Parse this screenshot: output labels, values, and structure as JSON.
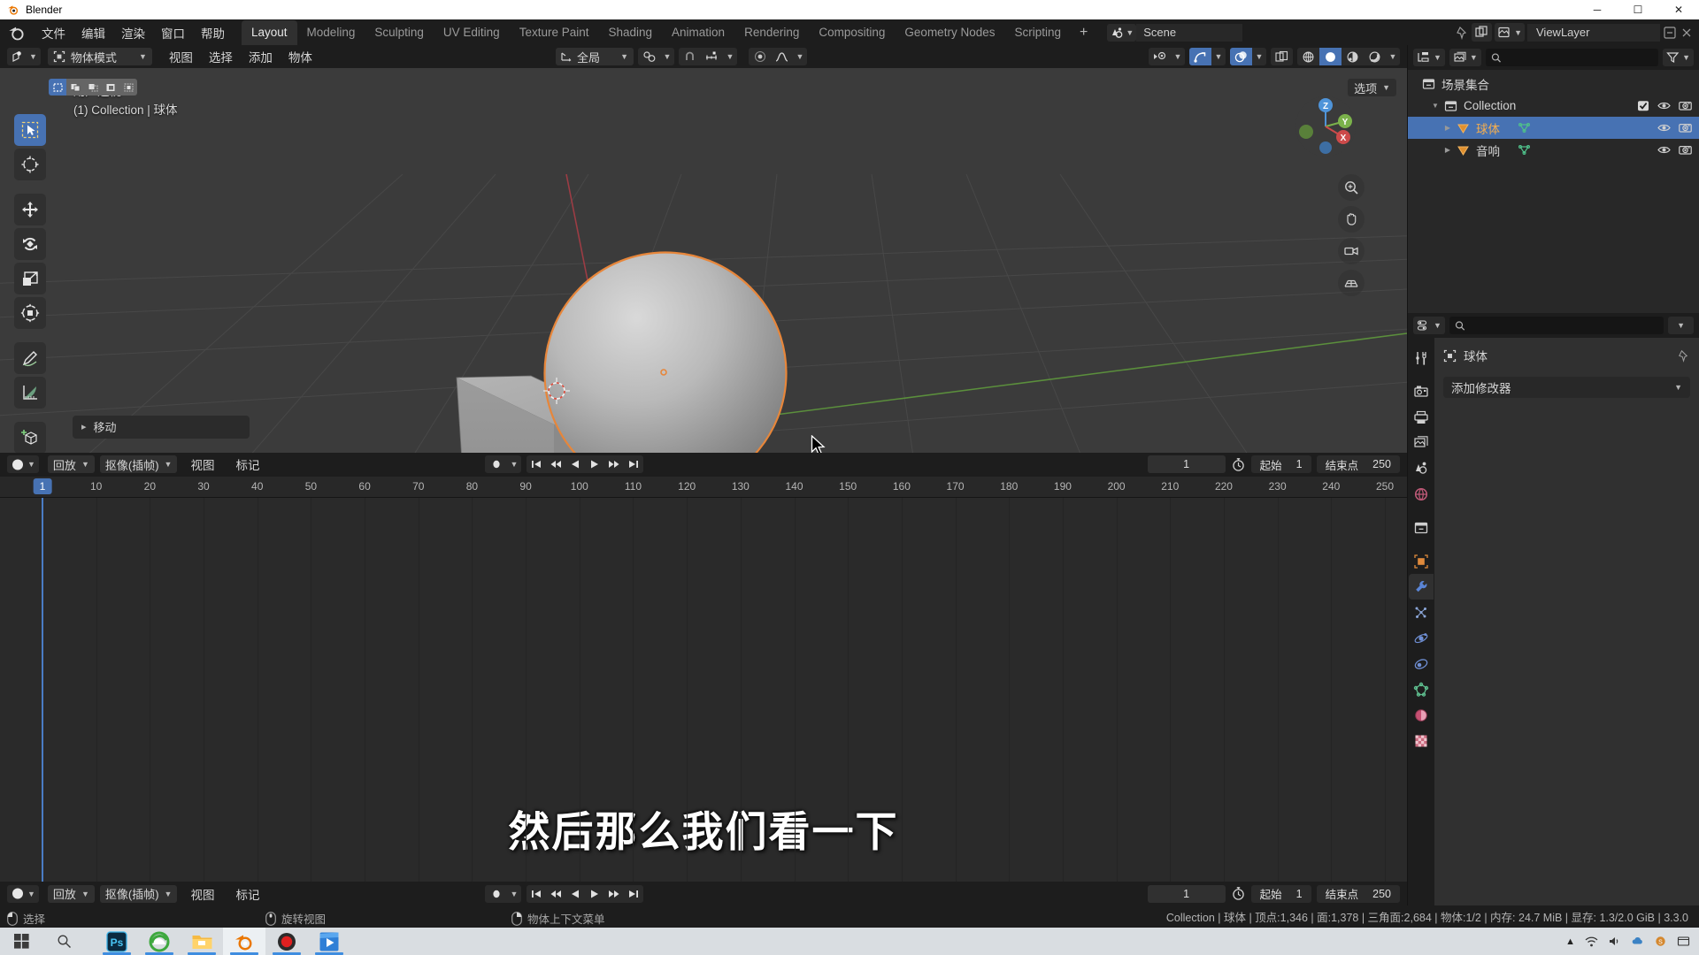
{
  "os": {
    "title": "Blender",
    "window_controls": [
      "minimize",
      "maximize",
      "close"
    ],
    "min_glyph": "─",
    "max_glyph": "☐",
    "close_glyph": "✕"
  },
  "topbar": {
    "menus": [
      "文件",
      "编辑",
      "渲染",
      "窗口",
      "帮助"
    ],
    "workspaces": [
      "Layout",
      "Modeling",
      "Sculpting",
      "UV Editing",
      "Texture Paint",
      "Shading",
      "Animation",
      "Rendering",
      "Compositing",
      "Geometry Nodes",
      "Scripting"
    ],
    "active_workspace": "Layout",
    "add_workspace": "+",
    "scene_name": "Scene",
    "viewlayer_name": "ViewLayer",
    "accent": "#4772b3"
  },
  "viewport_header": {
    "mode": "物体模式",
    "menus": [
      "视图",
      "选择",
      "添加",
      "物体"
    ],
    "transform_orientation": "全局",
    "icons": [
      "editor-type-icon",
      "snap-magnet-icon",
      "snap-increment-icon",
      "proportional-edit-icon",
      "proportional-falloff-icon",
      "visibility-icon",
      "gizmo-icon",
      "overlays-icon",
      "xray-icon",
      "shading-wireframe-icon",
      "shading-solid-icon",
      "shading-material-icon",
      "shading-rendered-icon"
    ]
  },
  "viewport": {
    "view_label": "用户透视",
    "collection_label": "(1) Collection | 球体",
    "options_label": "选项",
    "operator_panel": "移动",
    "gizmo_axes": [
      "X",
      "Y",
      "Z"
    ],
    "tools": [
      {
        "name": "tweak-tool",
        "active": true
      },
      {
        "name": "cursor-tool",
        "active": false
      },
      {
        "name": "move-tool",
        "active": false
      },
      {
        "name": "rotate-tool",
        "active": false
      },
      {
        "name": "scale-tool",
        "active": false
      },
      {
        "name": "transform-tool",
        "active": false
      },
      {
        "name": "annotate-tool",
        "active": false
      },
      {
        "name": "measure-tool",
        "active": false
      },
      {
        "name": "add-cube-tool",
        "active": false
      }
    ],
    "select_modes": [
      "set",
      "extend",
      "subtract",
      "invert",
      "intersect"
    ]
  },
  "outliner": {
    "root": "场景集合",
    "rows": [
      {
        "label": "Collection",
        "depth": 1,
        "type": "collection",
        "expanded": true,
        "selected": false,
        "checkbox": true,
        "eye": true,
        "camera": true
      },
      {
        "label": "球体",
        "depth": 2,
        "type": "mesh",
        "expanded": false,
        "selected": true,
        "checkbox": false,
        "eye": true,
        "camera": true
      },
      {
        "label": "音响",
        "depth": 2,
        "type": "mesh",
        "expanded": false,
        "selected": false,
        "checkbox": false,
        "eye": true,
        "camera": true
      }
    ],
    "search_placeholder": ""
  },
  "properties": {
    "object_name": "球体",
    "add_modifier": "添加修改器",
    "active_tab": "modifier",
    "tabs": [
      "tool-icon",
      "render-icon",
      "output-icon",
      "viewlayer-icon",
      "scene-icon",
      "world-icon",
      "collection-icon",
      "object-icon",
      "modifier-icon",
      "particles-icon",
      "physics-icon",
      "constraints-icon",
      "data-icon",
      "material-icon",
      "texture-icon"
    ],
    "search_placeholder": ""
  },
  "timeline": {
    "editor_menus": [
      "回放",
      "抠像(插帧)",
      "视图",
      "标记"
    ],
    "current_frame": "1",
    "start_label": "起始",
    "start_value": "1",
    "end_label": "结束点",
    "end_value": "250",
    "ruler_ticks": [
      "1",
      "10",
      "20",
      "30",
      "40",
      "50",
      "60",
      "70",
      "80",
      "90",
      "100",
      "110",
      "120",
      "130",
      "140",
      "150",
      "160",
      "170",
      "180",
      "190",
      "200",
      "210",
      "220",
      "230",
      "240",
      "250"
    ],
    "playhead_frame": "1",
    "playhead_color": "#4772b3"
  },
  "subtitle": {
    "text": "然后那么我们看一下"
  },
  "statusbar": {
    "hints": [
      {
        "icon": "mouse-left-icon",
        "label": "选择"
      },
      {
        "icon": "mouse-middle-icon",
        "label": "旋转视图"
      },
      {
        "icon": "mouse-right-icon",
        "label": "物体上下文菜单"
      }
    ],
    "stats": "Collection | 球体 | 顶点:1,346 | 面:1,378 | 三角面:2,684 | 物体:1/2 | 内存: 24.7 MiB | 显存: 1.3/2.0 GiB | 3.3.0"
  },
  "taskbar": {
    "items": [
      {
        "name": "start-button",
        "label": "⊞"
      },
      {
        "name": "search-button",
        "label": "⌕"
      },
      {
        "name": "photoshop-app",
        "label": "Ps",
        "running": true
      },
      {
        "name": "browser-app",
        "label": "e",
        "running": true
      },
      {
        "name": "file-explorer-app",
        "label": "",
        "running": true
      },
      {
        "name": "blender-app",
        "label": "",
        "running": true,
        "active": true
      },
      {
        "name": "recorder-app",
        "label": "",
        "running": true
      },
      {
        "name": "media-player-app",
        "label": "",
        "running": true
      }
    ],
    "tray": [
      "^",
      "network-icon",
      "volume-icon",
      "cloud-icon",
      "app-icon",
      "time"
    ]
  }
}
